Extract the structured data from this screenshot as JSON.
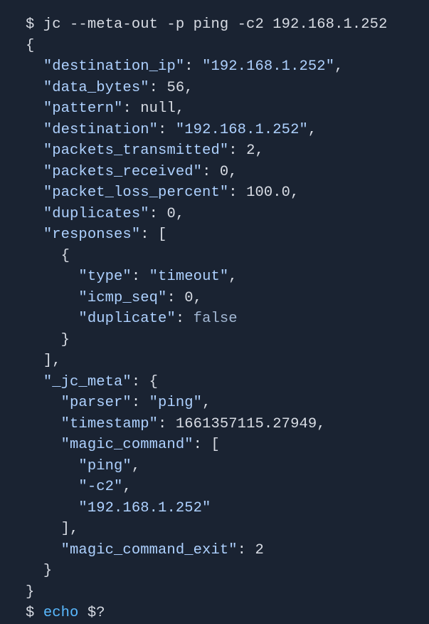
{
  "command": "$ jc --meta-out -p ping -c2 192.168.1.252",
  "brace_open": "{",
  "brace_close": "}",
  "bracket_close_comma": "],",
  "json": {
    "destination_ip": {
      "key": "\"destination_ip\"",
      "val": "\"192.168.1.252\""
    },
    "data_bytes": {
      "key": "\"data_bytes\"",
      "val": "56"
    },
    "pattern": {
      "key": "\"pattern\"",
      "val": "null"
    },
    "destination": {
      "key": "\"destination\"",
      "val": "\"192.168.1.252\""
    },
    "packets_transmitted": {
      "key": "\"packets_transmitted\"",
      "val": "2"
    },
    "packets_received": {
      "key": "\"packets_received\"",
      "val": "0"
    },
    "packet_loss_percent": {
      "key": "\"packet_loss_percent\"",
      "val": "100.0"
    },
    "duplicates": {
      "key": "\"duplicates\"",
      "val": "0"
    },
    "responses": {
      "key": "\"responses\""
    },
    "resp_type": {
      "key": "\"type\"",
      "val": "\"timeout\""
    },
    "resp_icmp_seq": {
      "key": "\"icmp_seq\"",
      "val": "0"
    },
    "resp_duplicate": {
      "key": "\"duplicate\"",
      "val": "false"
    },
    "jc_meta": {
      "key": "\"_jc_meta\""
    },
    "meta_parser": {
      "key": "\"parser\"",
      "val": "\"ping\""
    },
    "meta_timestamp": {
      "key": "\"timestamp\"",
      "val": "1661357115.27949"
    },
    "meta_magic_command": {
      "key": "\"magic_command\""
    },
    "mc_0": "\"ping\"",
    "mc_1": "\"-c2\"",
    "mc_2": "\"192.168.1.252\"",
    "meta_magic_command_exit": {
      "key": "\"magic_command_exit\"",
      "val": "2"
    }
  },
  "trailing": {
    "prompt": "$ ",
    "cmdfrag": "echo",
    "rest": " $?"
  }
}
